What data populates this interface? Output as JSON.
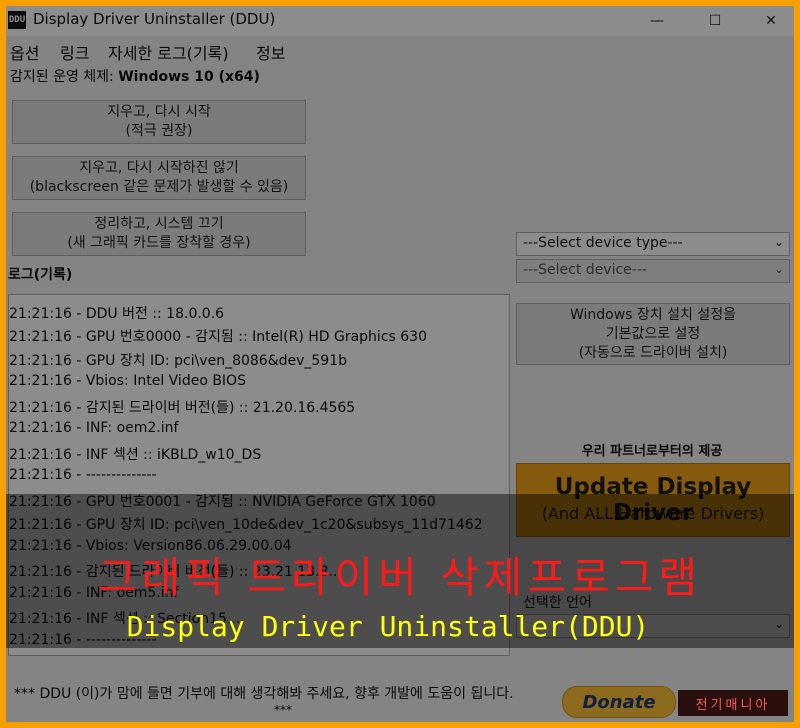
{
  "window": {
    "title": "Display Driver Uninstaller (DDU)",
    "controls": {
      "minimize": "—",
      "maximize": "☐",
      "close": "✕"
    }
  },
  "menu": [
    "옵션",
    "링크",
    "자세한 로그(기록)",
    "정보"
  ],
  "os": {
    "label": "감지된 운영 체제:",
    "value": "Windows 10 (x64)"
  },
  "actions": [
    {
      "line1": "지우고, 다시 시작",
      "line2": "(적극 권장)"
    },
    {
      "line1": "지우고, 다시 시작하진 않기",
      "line2": "(blackscreen 같은 문제가 발생할 수 있음)"
    },
    {
      "line1": "정리하고, 시스템 끄기",
      "line2": "(새 그래픽 카드를 장착할 경우)"
    }
  ],
  "log": {
    "label": "로그(기록)",
    "lines": [
      "21:21:16 - DDU 버전 :: 18.0.0.6",
      "21:21:16 - GPU 번호0000 - 감지됨 :: Intel(R) HD Graphics 630",
      "21:21:16 - GPU 장치 ID: pci\\ven_8086&dev_591b",
      "21:21:16 - Vbios: Intel Video BIOS",
      "21:21:16 - 감지된 드라이버 버전(들) :: 21.20.16.4565",
      "21:21:16 - INF: oem2.inf",
      "21:21:16 - INF 섹션 :: iKBLD_w10_DS",
      "21:21:16 - --------------",
      "21:21:16 - GPU 번호0001 - 감지됨 :: NVIDIA GeForce GTX 1060",
      "21:21:16 - GPU 장치 ID: pci\\ven_10de&dev_1c20&subsys_11d71462",
      "21:21:16 - Vbios: Version86.06.29.00.04",
      "21:21:16 - 감지된 드라이버 버전(들) :: 23.21.13.8...",
      "21:21:16 - INF: oem5.inf",
      "21:21:16 - INF 섹션 :: Section15...",
      "21:21:16 - --------------"
    ]
  },
  "device": {
    "type_placeholder": "---Select device type---",
    "device_placeholder": "---Select device---"
  },
  "reset_button": {
    "line1": "Windows 장치 설치 설정을",
    "line2": "기본값으로 설정",
    "line3": "(자동으로 드라이버 설치)"
  },
  "partner": {
    "label": "우리 파트너로부터의 제공",
    "ad_title": "Update Display Driver",
    "ad_subtitle": "(And ALL Hardware Drivers)"
  },
  "language": {
    "label": "선택한 언어"
  },
  "footer": {
    "message": "*** DDU (이)가 맘에 들면 기부에 대해 생각해봐 주세요, 향후 개발에 도움이 됩니다.",
    "stars": "***",
    "donate": "Donate"
  },
  "overlay": {
    "title": "그래픽 드라이버 삭제프로그램",
    "subtitle": "Display Driver Uninstaller(DDU)",
    "watermark": "전기매니아"
  },
  "icons": {
    "app": "ddu-app-icon",
    "chevron": "chevron-down-icon"
  },
  "colors": {
    "frame": "#f6a000",
    "overlay_title": "#ff1a1a",
    "overlay_subtitle": "#ffff10",
    "ad_banner": "#f3a21a"
  }
}
